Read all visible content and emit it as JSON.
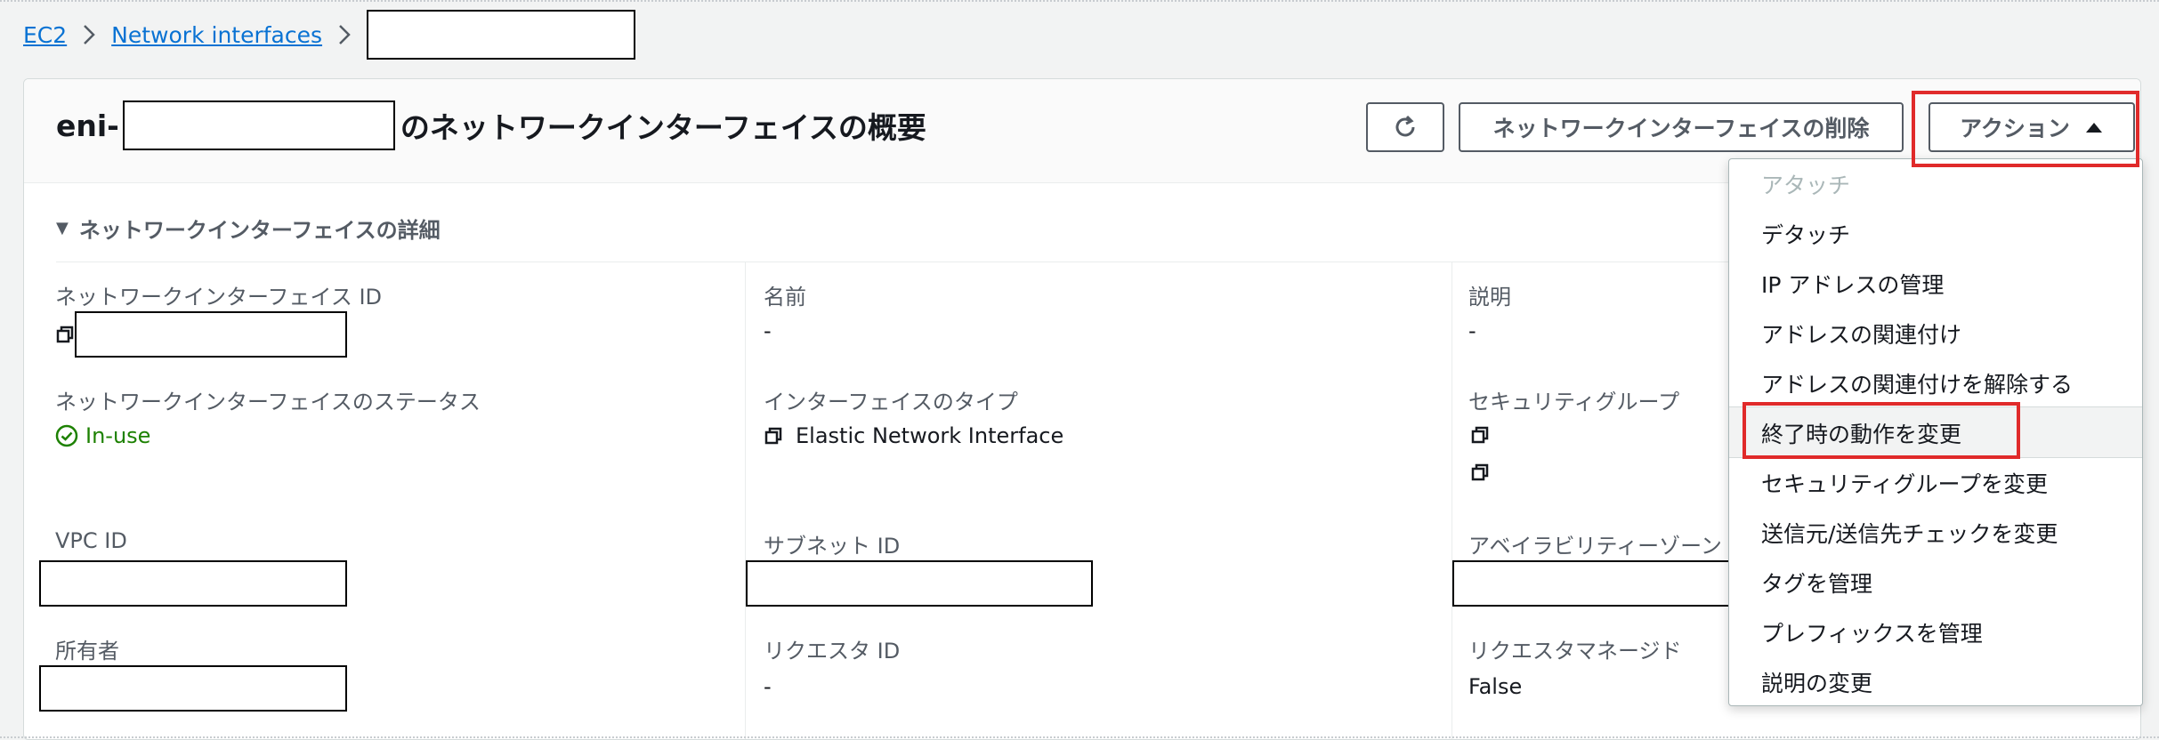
{
  "breadcrumb": {
    "root": "EC2",
    "section": "Network interfaces"
  },
  "header": {
    "title_prefix": "eni-",
    "title_suffix": "のネットワークインターフェイスの概要",
    "delete_label": "ネットワークインターフェイスの削除",
    "action_label": "アクション"
  },
  "details": {
    "section_title": "ネットワークインターフェイスの詳細",
    "eni_id_label": "ネットワークインターフェイス ID",
    "name_label": "名前",
    "name_value": "-",
    "description_label": "説明",
    "description_value": "-",
    "status_label": "ネットワークインターフェイスのステータス",
    "status_value": "In-use",
    "interface_type_label": "インターフェイスのタイプ",
    "interface_type_value": "Elastic Network Interface",
    "security_group_label": "セキュリティグループ",
    "vpc_label": "VPC ID",
    "subnet_label": "サブネット ID",
    "az_label": "アベイラビリティーゾーン",
    "owner_label": "所有者",
    "requester_id_label": "リクエスタ ID",
    "requester_id_value": "-",
    "requester_managed_label": "リクエスタマネージド",
    "requester_managed_value": "False"
  },
  "menu": {
    "items": [
      "アタッチ",
      "デタッチ",
      "IP アドレスの管理",
      "アドレスの関連付け",
      "アドレスの関連付けを解除する",
      "終了時の動作を変更",
      "セキュリティグループを変更",
      "送信元/送信先チェックを変更",
      "タグを管理",
      "プレフィックスを管理",
      "説明の変更"
    ],
    "disabled_index": 0,
    "highlighted_index": 5
  },
  "colors": {
    "link": "#0972d3",
    "success": "#1d8102",
    "highlight": "#e02a2a"
  },
  "icons": [
    "chevron-right-icon",
    "refresh-icon",
    "caret-up-icon",
    "caret-down-icon",
    "copy-icon",
    "check-circle-icon"
  ]
}
